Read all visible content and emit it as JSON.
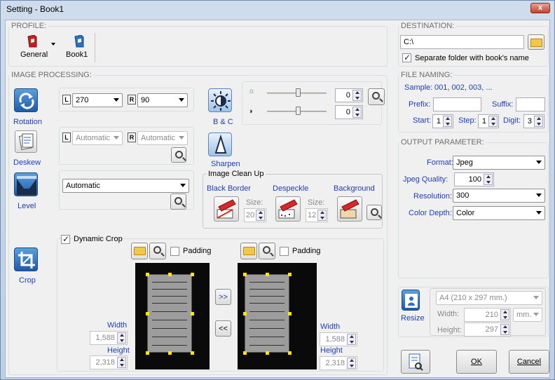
{
  "window": {
    "title": "Setting - Book1",
    "close_label": "x"
  },
  "profile": {
    "group_title": "PROFILE:",
    "items": [
      {
        "label": "General"
      },
      {
        "label": "Book1"
      }
    ]
  },
  "image_processing": {
    "group_title": "IMAGE PROCESSING:",
    "rotation": {
      "label": "Rotation",
      "left_badge": "L",
      "right_badge": "R",
      "left_value": "270",
      "right_value": "90"
    },
    "deskew": {
      "label": "Deskew",
      "left_value": "Automatic",
      "right_value": "Automatic"
    },
    "level": {
      "label": "Level",
      "value": "Automatic"
    },
    "bc": {
      "label": "B & C",
      "brightness": "0",
      "contrast": "0"
    },
    "sharpen": {
      "label": "Sharpen"
    },
    "clean_up": {
      "title": "Image Clean Up",
      "black_border": "Black Border",
      "despeckle": "Despeckle",
      "background": "Background",
      "size_label": "Size:",
      "black_border_size": "20",
      "despeckle_size": "12"
    },
    "crop": {
      "label": "Crop",
      "dynamic_crop_label": "Dynamic Crop",
      "dynamic_crop_checked": true,
      "padding_label": "Padding",
      "width_label": "Width",
      "height_label": "Height",
      "left_width": "1,588",
      "left_height": "2,318",
      "right_width": "1,588",
      "right_height": "2,318",
      "copy_right": ">>",
      "copy_left": "<<"
    }
  },
  "destination": {
    "group_title": "DESTINATION:",
    "path": "C:\\",
    "separate_folder_label": "Separate folder with book's name",
    "separate_folder_checked": true
  },
  "file_naming": {
    "group_title": "FILE NAMING:",
    "sample_label": "Sample:",
    "sample_value": "001, 002, 003, ...",
    "prefix_label": "Prefix:",
    "suffix_label": "Suffix:",
    "start_label": "Start:",
    "start_value": "1",
    "step_label": "Step:",
    "step_value": "1",
    "digit_label": "Digit:",
    "digit_value": "3"
  },
  "output": {
    "group_title": "OUTPUT PARAMETER:",
    "format_label": "Format:",
    "format_value": "Jpeg",
    "quality_label": "Jpeg Quality:",
    "quality_value": "100",
    "resolution_label": "Resolution:",
    "resolution_value": "300",
    "color_depth_label": "Color Depth:",
    "color_depth_value": "Color"
  },
  "resize": {
    "label": "Resize",
    "paper_value": "A4 (210 x 297 mm.)",
    "width_label": "Width:",
    "width_value": "210",
    "unit_value": "mm.",
    "height_label": "Height:",
    "height_value": "297"
  },
  "buttons": {
    "ok": "OK",
    "cancel": "Cancel"
  },
  "colors": {
    "accent_blue": "#1e3dbf",
    "icon_blue": "#2e6fbf",
    "profile_red": "#c81e1e"
  }
}
